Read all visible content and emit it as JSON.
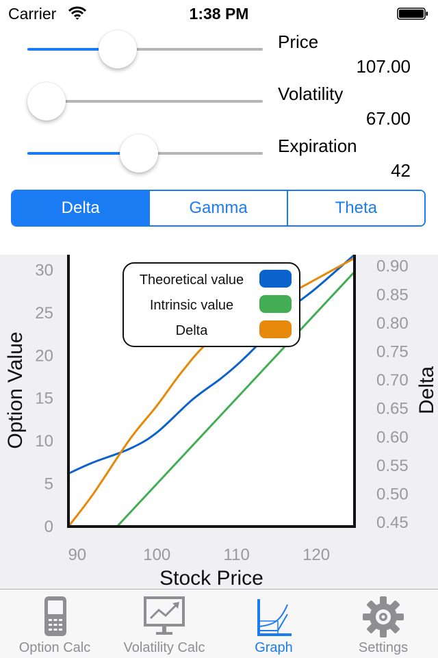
{
  "status_bar": {
    "carrier": "Carrier",
    "time": "1:38 PM",
    "wifi_icon": "wifi-icon",
    "battery_icon": "battery-icon",
    "battery_level": 1.0
  },
  "controls": {
    "sliders": [
      {
        "label": "Price",
        "value": "107.00",
        "fraction": 0.36
      },
      {
        "label": "Volatility",
        "value": "67.00",
        "fraction": 0.0
      },
      {
        "label": "Expiration",
        "value": "42",
        "fraction": 0.47
      }
    ],
    "accent_color": "#1a7bf2"
  },
  "segmented_control": {
    "segments": [
      "Delta",
      "Gamma",
      "Theta"
    ],
    "selected": 0
  },
  "chart_data": {
    "type": "line",
    "title": "",
    "xlabel": "Stock Price",
    "ylabel": "Option Value",
    "y2label": "Delta",
    "xlim": [
      88.9,
      124.8
    ],
    "ylim": [
      0,
      31.8
    ],
    "y2lim": [
      0.443,
      0.92
    ],
    "xticks": [
      90,
      100,
      110,
      120
    ],
    "yticks": [
      0,
      5,
      10,
      15,
      20,
      25,
      30
    ],
    "y2ticks": [
      "0.45",
      "0.50",
      "0.55",
      "0.60",
      "0.65",
      "0.70",
      "0.75",
      "0.80",
      "0.85",
      "0.90"
    ],
    "grid": false,
    "legend_position": "top-center",
    "series": [
      {
        "name": "Theoretical value",
        "color": "#0a62cc",
        "axis": "left",
        "x": [
          88.9,
          92,
          96.6,
          100,
          104.4,
          108,
          110.4,
          113,
          116.4,
          120,
          124.8
        ],
        "y": [
          6.2,
          7.5,
          9.1,
          11.0,
          14.8,
          17.3,
          19.2,
          21.6,
          25.2,
          27.9,
          31.8
        ]
      },
      {
        "name": "Intrinsic value",
        "color": "#43ad54",
        "axis": "left",
        "x": [
          88.9,
          95.0,
          124.8
        ],
        "y": [
          0,
          0,
          29.8
        ]
      },
      {
        "name": "Delta",
        "color": "#e6890a",
        "axis": "right",
        "x": [
          88.9,
          92,
          96.6,
          100,
          103,
          106.1,
          110,
          114.7,
          118,
          121,
          124.8
        ],
        "y": [
          0.443,
          0.5,
          0.596,
          0.655,
          0.712,
          0.762,
          0.803,
          0.839,
          0.862,
          0.885,
          0.914
        ]
      }
    ]
  },
  "tab_bar": {
    "tabs": [
      {
        "label": "Option Calc",
        "icon": "calculator-icon",
        "active": false
      },
      {
        "label": "Volatility Calc",
        "icon": "chart-monitor-icon",
        "active": false
      },
      {
        "label": "Graph",
        "icon": "graph-icon",
        "active": true
      },
      {
        "label": "Settings",
        "icon": "gear-icon",
        "active": false
      }
    ],
    "active_color": "#1a7bf2",
    "inactive_color": "#8e8e93"
  }
}
